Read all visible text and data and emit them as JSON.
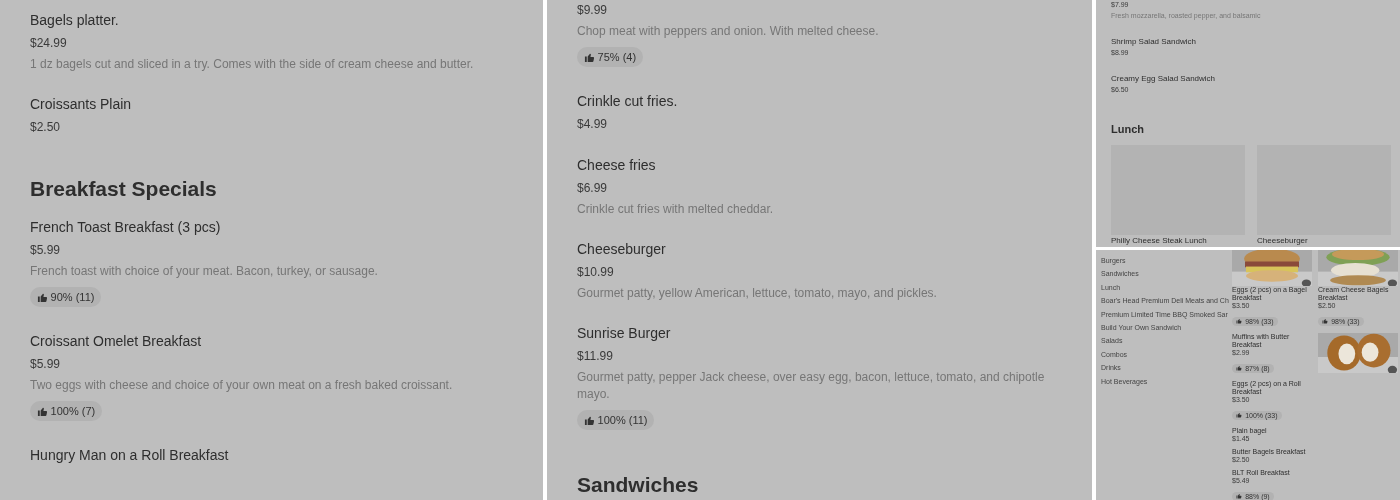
{
  "left_panel": {
    "entries": [
      {
        "kind": "item",
        "name": "Bagels platter.",
        "price": "$24.99",
        "description": "1 dz bagels cut and sliced in a try. Comes with the side of cream cheese and butter."
      },
      {
        "kind": "item",
        "name": "Croissants Plain",
        "price": "$2.50"
      },
      {
        "kind": "heading",
        "title": "Breakfast Specials"
      },
      {
        "kind": "item",
        "name": "French Toast Breakfast (3 pcs)",
        "price": "$5.99",
        "description": "French toast with choice of your meat. Bacon, turkey, or sausage.",
        "rating": "90% (11)"
      },
      {
        "kind": "item",
        "name": "Croissant Omelet Breakfast",
        "price": "$5.99",
        "description": "Two eggs with cheese and choice of your own meat on a fresh baked croissant.",
        "rating": "100% (7)"
      },
      {
        "kind": "item",
        "name": "Hungry Man on a Roll Breakfast"
      }
    ]
  },
  "middle_panel": {
    "entries": [
      {
        "kind": "item",
        "price": "$9.99",
        "description": "Chop meat with peppers and onion. With melted cheese.",
        "rating": "75% (4)"
      },
      {
        "kind": "item",
        "name": "Crinkle cut fries.",
        "price": "$4.99"
      },
      {
        "kind": "item",
        "name": "Cheese fries",
        "price": "$6.99",
        "description": "Crinkle cut fries with melted cheddar."
      },
      {
        "kind": "item",
        "name": "Cheeseburger",
        "price": "$10.99",
        "description": "Gourmet patty, yellow American, lettuce, tomato, mayo, and pickles."
      },
      {
        "kind": "item",
        "name": "Sunrise Burger",
        "price": "$11.99",
        "description": "Gourmet patty, pepper Jack cheese, over easy egg, bacon, lettuce, tomato, and chipotle mayo.",
        "rating": "100% (11)"
      },
      {
        "kind": "heading",
        "title": "Sandwiches"
      }
    ]
  },
  "top_right_panel": {
    "entries": [
      {
        "kind": "item",
        "price": "$7.99",
        "description": "Fresh mozzarella, roasted pepper, and balsamic"
      },
      {
        "kind": "item",
        "name": "Shrimp Salad Sandwich",
        "price": "$8.99"
      },
      {
        "kind": "item",
        "name": "Creamy Egg Salad Sandwich",
        "price": "$6.50"
      },
      {
        "kind": "heading",
        "title": "Lunch"
      },
      {
        "kind": "cards",
        "cards": [
          {
            "name": "Philly Cheese Steak Lunch"
          },
          {
            "name": "Cheeseburger"
          }
        ]
      }
    ]
  },
  "bottom_right_panel": {
    "categories": [
      "Burgers",
      "Sandwiches",
      "Lunch",
      "Boar's Head Premium Deli Meats and Ch",
      "Premium Limited Time BBQ Smoked Sar",
      "Build Your Own Sandwich",
      "Salads",
      "Combos",
      "Drinks",
      "Hot Beverages"
    ],
    "rows": [
      [
        {
          "kind": "item",
          "picture": true,
          "name": "Eggs (2 pcs) on a Bagel Breakfast",
          "price": "$3.50",
          "rating": "98% (33)"
        },
        {
          "kind": "item",
          "picture": true,
          "name": "Cream Cheese Bagels Breakfast",
          "price": "$2.50",
          "rating": "98% (33)"
        }
      ],
      [
        {
          "kind": "item",
          "name": "Muffins with Butter Breakfast",
          "price": "$2.99",
          "rating": "87% (8)"
        },
        {
          "kind": "picture"
        }
      ],
      [
        {
          "kind": "item",
          "name": "Eggs (2 pcs) on a Roll Breakfast",
          "price": "$3.50",
          "rating": "100% (33)"
        }
      ],
      [
        {
          "kind": "item",
          "name": "Plain bagel",
          "price": "$1.45"
        }
      ],
      [
        {
          "kind": "item",
          "name": "Butter Bagels Breakfast",
          "price": "$2.50"
        }
      ],
      [
        {
          "kind": "item",
          "name": "BLT Roll Breakfast",
          "price": "$5.49",
          "rating": "88% (9)"
        }
      ]
    ]
  }
}
